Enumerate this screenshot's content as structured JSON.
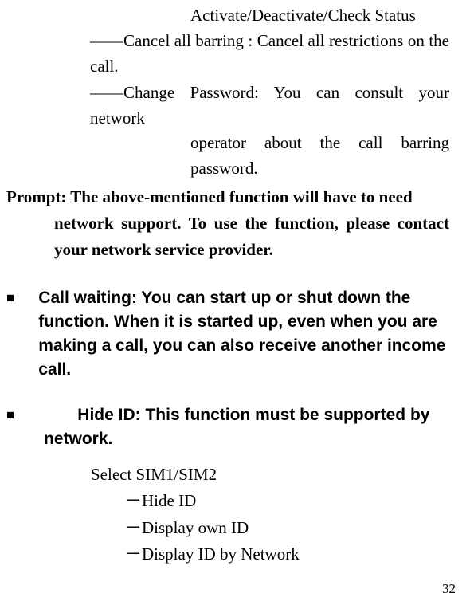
{
  "line1": "Activate/Deactivate/Check Status",
  "cancel_all": "――Cancel all barring : Cancel all restrictions on the call.",
  "cancel_continue": "call.",
  "change_pw_1": "――Change Password: You can consult your network",
  "change_pw_2": "operator about the call barring password.",
  "prompt_1": "Prompt: The above-mentioned function will have to need",
  "prompt_2": "network support. To use the function, please contact your network service provider.",
  "bullet1": "Call waiting: You can start up or shut down the function. When it is started up, even when you are making a call, you can also receive another income call.",
  "bullet2_line1": "Hide ID: This function must be supported by",
  "bullet2_line2": "network.",
  "select": "Select SIM1/SIM2",
  "opt1": "－Hide ID",
  "opt2": "－Display own ID",
  "opt3": "－Display ID by Network",
  "page": "32"
}
